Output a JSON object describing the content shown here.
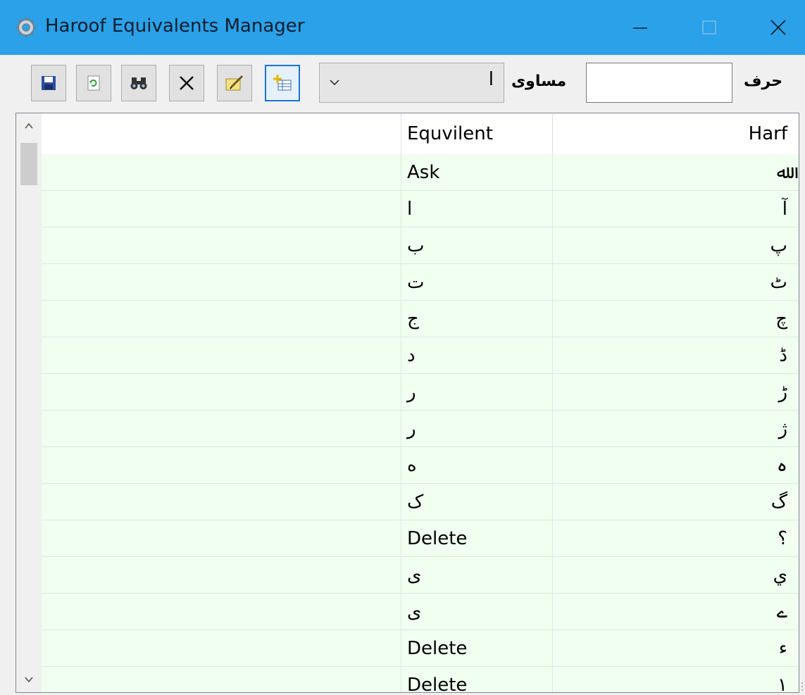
{
  "window": {
    "title": "Haroof Equivalents Manager",
    "accent_color": "#2aa1e8",
    "icon": "gear-icon"
  },
  "toolbar": {
    "buttons": [
      {
        "name": "save-button",
        "icon": "floppy-disk-icon"
      },
      {
        "name": "refresh-button",
        "icon": "refresh-icon"
      },
      {
        "name": "find-button",
        "icon": "binoculars-icon"
      },
      {
        "name": "delete-button",
        "icon": "x-icon"
      },
      {
        "name": "edit-button",
        "icon": "pencil-note-icon"
      },
      {
        "name": "add-button",
        "icon": "add-record-icon"
      }
    ],
    "equivalent_label": "مساوی",
    "equivalent_value": "ا",
    "harf_label": "حرف",
    "harf_value": ""
  },
  "grid": {
    "columns": {
      "equivalent": "Equvilent",
      "harf": "Harf"
    },
    "row_background": "#f0fff0",
    "rows": [
      {
        "equivalent": "Ask",
        "harf": "ﷲ"
      },
      {
        "equivalent": "ا",
        "harf": "آ"
      },
      {
        "equivalent": "ب",
        "harf": "پ"
      },
      {
        "equivalent": "ت",
        "harf": "ٹ"
      },
      {
        "equivalent": "ج",
        "harf": "چ"
      },
      {
        "equivalent": "د",
        "harf": "ڈ"
      },
      {
        "equivalent": "ر",
        "harf": "ڑ"
      },
      {
        "equivalent": "ر",
        "harf": "ژ"
      },
      {
        "equivalent": "ه",
        "harf": "ہ"
      },
      {
        "equivalent": "ک",
        "harf": "گ"
      },
      {
        "equivalent": "Delete",
        "harf": "؟"
      },
      {
        "equivalent": "ی",
        "harf": "ي"
      },
      {
        "equivalent": "ی",
        "harf": "ے"
      },
      {
        "equivalent": "Delete",
        "harf": "ء"
      },
      {
        "equivalent": "Delete",
        "harf": "۱"
      }
    ]
  }
}
